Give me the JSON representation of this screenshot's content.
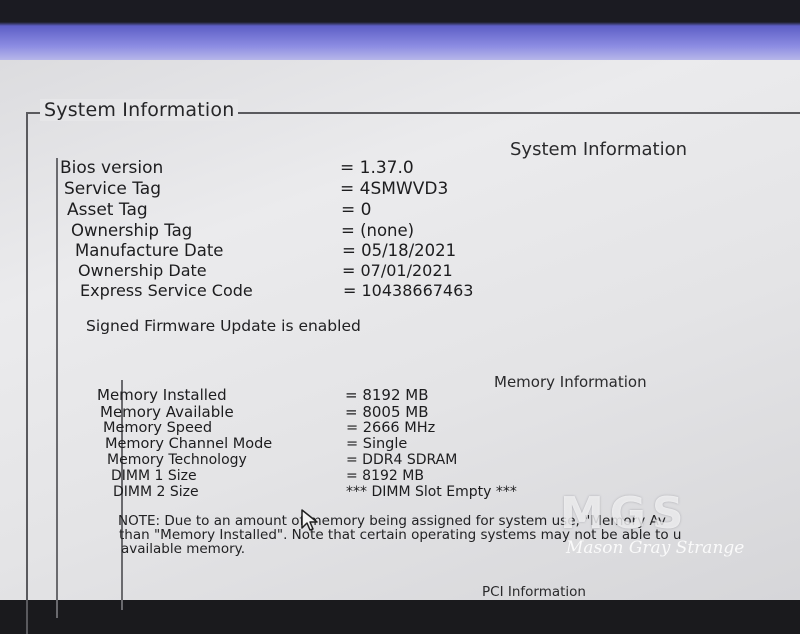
{
  "groupbox": {
    "title": "System Information"
  },
  "system": {
    "heading": "System Information",
    "rows": [
      {
        "label": "Bios version",
        "value": "= 1.37.0"
      },
      {
        "label": "Service Tag",
        "value": "= 4SMWVD3"
      },
      {
        "label": "Asset Tag",
        "value": "= 0"
      },
      {
        "label": "Ownership Tag",
        "value": "= (none)"
      },
      {
        "label": "Manufacture Date",
        "value": "= 05/18/2021"
      },
      {
        "label": "Ownership Date",
        "value": "= 07/01/2021"
      },
      {
        "label": "Express Service Code",
        "value": "= 10438667463"
      }
    ],
    "firmware_status": "Signed Firmware Update is enabled"
  },
  "memory": {
    "heading": "Memory Information",
    "rows": [
      {
        "label": "Memory Installed",
        "value": "= 8192 MB"
      },
      {
        "label": "Memory Available",
        "value": "= 8005 MB"
      },
      {
        "label": "Memory Speed",
        "value": "= 2666 MHz"
      },
      {
        "label": "Memory Channel Mode",
        "value": "= Single"
      },
      {
        "label": "Memory Technology",
        "value": "= DDR4 SDRAM"
      },
      {
        "label": "DIMM 1 Size",
        "value": "= 8192 MB"
      },
      {
        "label": "DIMM 2 Size",
        "value": "*** DIMM Slot Empty ***"
      }
    ],
    "note_lines": [
      "NOTE: Due to an amount of memory being assigned for system use, \"Memory Av",
      "than \"Memory Installed\". Note that certain operating systems may not be able to u",
      "available memory."
    ]
  },
  "pci": {
    "heading": "PCI Information"
  },
  "watermark": {
    "logo": "MGS",
    "name": "Mason Gray Strange"
  }
}
